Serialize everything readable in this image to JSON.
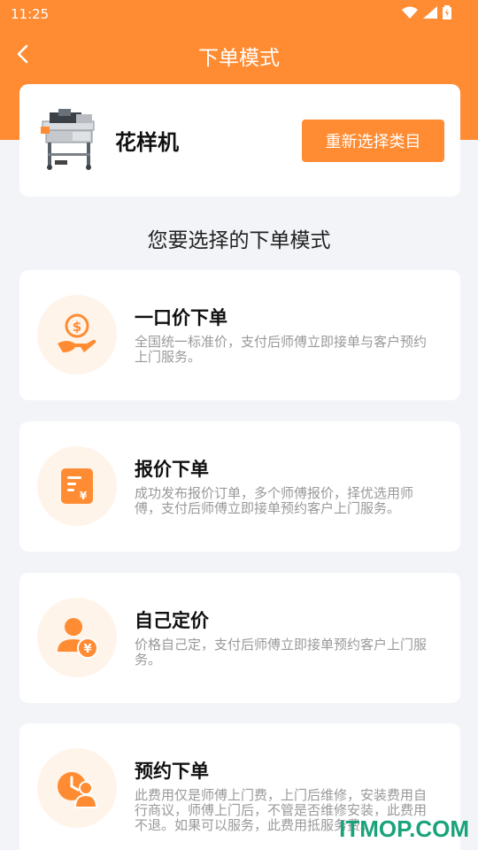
{
  "status_bar": {
    "time": "11:25"
  },
  "nav": {
    "title": "下单模式"
  },
  "product": {
    "name": "花样机",
    "reselect_label": "重新选择类目"
  },
  "section": {
    "title": "您要选择的下单模式"
  },
  "modes": [
    {
      "title": "一口价下单",
      "desc": "全国统一标准价，支付后师傅立即接单与客户预约上门服务。",
      "icon": "coin-hand-icon"
    },
    {
      "title": "报价下单",
      "desc": "成功发布报价订单，多个师傅报价，择优选用师傅，支付后师傅立即接单预约客户上门服务。",
      "icon": "quote-document-icon"
    },
    {
      "title": "自己定价",
      "desc": "价格自己定，支付后师傅立即接单预约客户上门服务。",
      "icon": "user-price-icon"
    },
    {
      "title": "预约下单",
      "desc": "此费用仅是师傅上门费，上门后维修，安装费用自行商议，师傅上门后，不管是否维修安装，此费用不退。如果可以服务，此费用抵服务费。",
      "icon": "clock-user-icon"
    }
  ],
  "watermark": "ITMOP.COM",
  "colors": {
    "accent": "#ff8c33",
    "background": "#f2f4f8",
    "icon_bg": "#fff4ea"
  }
}
